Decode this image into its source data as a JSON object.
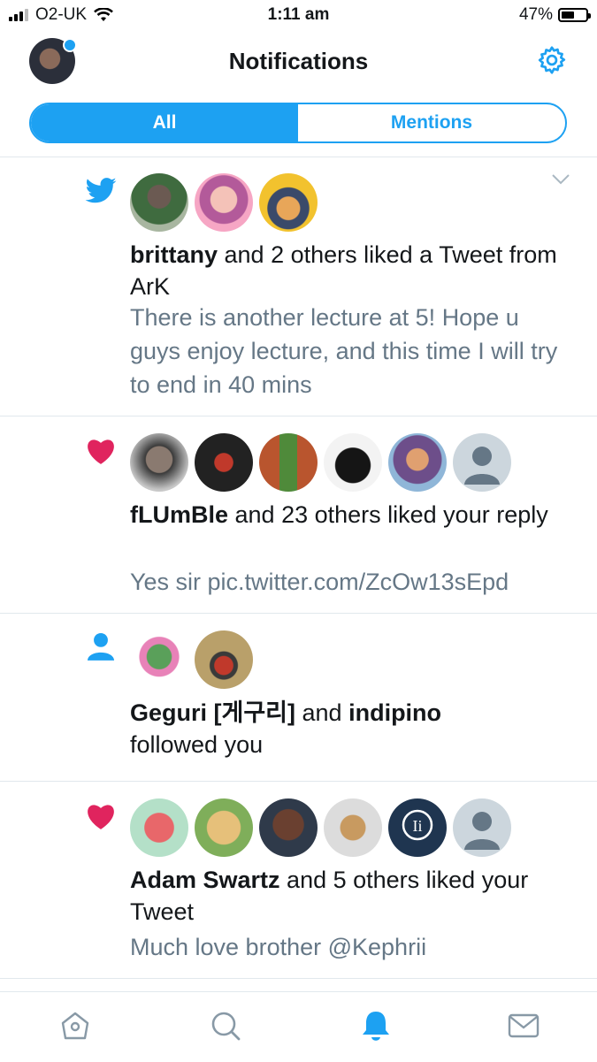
{
  "status_bar": {
    "carrier": "O2-UK",
    "time": "1:11 am",
    "battery": "47%",
    "battery_level": 0.47
  },
  "header": {
    "title": "Notifications"
  },
  "tabs": {
    "all": "All",
    "mentions": "Mentions",
    "selected": "All"
  },
  "notifications": [
    {
      "type": "like-retweet-icon",
      "actor": "brittany",
      "action": " and 2 others liked a Tweet from ArK",
      "snippet": "There is another lecture at 5! Hope u guys enjoy lecture, and this time I will try to end in 40 mins"
    },
    {
      "type": "heart-icon",
      "actor": "fLUmBle",
      "action": " and 23 others liked your reply",
      "snippet": "Yes sir pic.twitter.com/ZcOw13sEpd"
    },
    {
      "type": "person-icon",
      "actor": "Geguri  [게구리]",
      "connector": " and ",
      "actor2": "indipino",
      "action": "followed you"
    },
    {
      "type": "heart-icon",
      "actor": "Adam Swartz",
      "action": " and 5 others liked your Tweet",
      "snippet": "Much love brother @Kephrii"
    }
  ],
  "colors": {
    "accent": "#1da1f2",
    "like": "#e0245e",
    "muted": "#657786",
    "divider": "#e1e8ed"
  },
  "tabbar": [
    "home-icon",
    "search-icon",
    "bell-icon",
    "mail-icon"
  ]
}
